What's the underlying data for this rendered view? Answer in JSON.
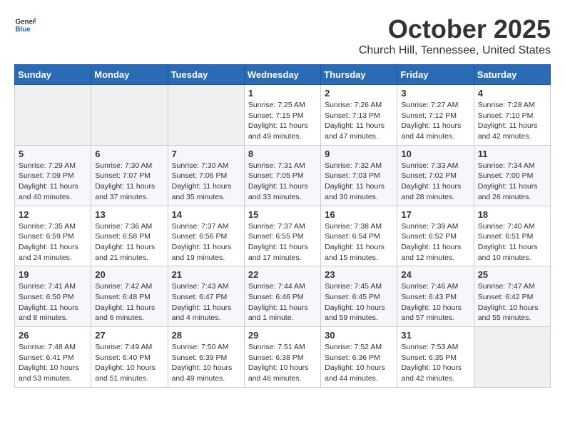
{
  "header": {
    "logo_general": "General",
    "logo_blue": "Blue",
    "month": "October 2025",
    "location": "Church Hill, Tennessee, United States"
  },
  "weekdays": [
    "Sunday",
    "Monday",
    "Tuesday",
    "Wednesday",
    "Thursday",
    "Friday",
    "Saturday"
  ],
  "weeks": [
    [
      {
        "day": "",
        "info": ""
      },
      {
        "day": "",
        "info": ""
      },
      {
        "day": "",
        "info": ""
      },
      {
        "day": "1",
        "info": "Sunrise: 7:25 AM\nSunset: 7:15 PM\nDaylight: 11 hours\nand 49 minutes."
      },
      {
        "day": "2",
        "info": "Sunrise: 7:26 AM\nSunset: 7:13 PM\nDaylight: 11 hours\nand 47 minutes."
      },
      {
        "day": "3",
        "info": "Sunrise: 7:27 AM\nSunset: 7:12 PM\nDaylight: 11 hours\nand 44 minutes."
      },
      {
        "day": "4",
        "info": "Sunrise: 7:28 AM\nSunset: 7:10 PM\nDaylight: 11 hours\nand 42 minutes."
      }
    ],
    [
      {
        "day": "5",
        "info": "Sunrise: 7:29 AM\nSunset: 7:09 PM\nDaylight: 11 hours\nand 40 minutes."
      },
      {
        "day": "6",
        "info": "Sunrise: 7:30 AM\nSunset: 7:07 PM\nDaylight: 11 hours\nand 37 minutes."
      },
      {
        "day": "7",
        "info": "Sunrise: 7:30 AM\nSunset: 7:06 PM\nDaylight: 11 hours\nand 35 minutes."
      },
      {
        "day": "8",
        "info": "Sunrise: 7:31 AM\nSunset: 7:05 PM\nDaylight: 11 hours\nand 33 minutes."
      },
      {
        "day": "9",
        "info": "Sunrise: 7:32 AM\nSunset: 7:03 PM\nDaylight: 11 hours\nand 30 minutes."
      },
      {
        "day": "10",
        "info": "Sunrise: 7:33 AM\nSunset: 7:02 PM\nDaylight: 11 hours\nand 28 minutes."
      },
      {
        "day": "11",
        "info": "Sunrise: 7:34 AM\nSunset: 7:00 PM\nDaylight: 11 hours\nand 26 minutes."
      }
    ],
    [
      {
        "day": "12",
        "info": "Sunrise: 7:35 AM\nSunset: 6:59 PM\nDaylight: 11 hours\nand 24 minutes."
      },
      {
        "day": "13",
        "info": "Sunrise: 7:36 AM\nSunset: 6:58 PM\nDaylight: 11 hours\nand 21 minutes."
      },
      {
        "day": "14",
        "info": "Sunrise: 7:37 AM\nSunset: 6:56 PM\nDaylight: 11 hours\nand 19 minutes."
      },
      {
        "day": "15",
        "info": "Sunrise: 7:37 AM\nSunset: 6:55 PM\nDaylight: 11 hours\nand 17 minutes."
      },
      {
        "day": "16",
        "info": "Sunrise: 7:38 AM\nSunset: 6:54 PM\nDaylight: 11 hours\nand 15 minutes."
      },
      {
        "day": "17",
        "info": "Sunrise: 7:39 AM\nSunset: 6:52 PM\nDaylight: 11 hours\nand 12 minutes."
      },
      {
        "day": "18",
        "info": "Sunrise: 7:40 AM\nSunset: 6:51 PM\nDaylight: 11 hours\nand 10 minutes."
      }
    ],
    [
      {
        "day": "19",
        "info": "Sunrise: 7:41 AM\nSunset: 6:50 PM\nDaylight: 11 hours\nand 8 minutes."
      },
      {
        "day": "20",
        "info": "Sunrise: 7:42 AM\nSunset: 6:48 PM\nDaylight: 11 hours\nand 6 minutes."
      },
      {
        "day": "21",
        "info": "Sunrise: 7:43 AM\nSunset: 6:47 PM\nDaylight: 11 hours\nand 4 minutes."
      },
      {
        "day": "22",
        "info": "Sunrise: 7:44 AM\nSunset: 6:46 PM\nDaylight: 11 hours\nand 1 minute."
      },
      {
        "day": "23",
        "info": "Sunrise: 7:45 AM\nSunset: 6:45 PM\nDaylight: 10 hours\nand 59 minutes."
      },
      {
        "day": "24",
        "info": "Sunrise: 7:46 AM\nSunset: 6:43 PM\nDaylight: 10 hours\nand 57 minutes."
      },
      {
        "day": "25",
        "info": "Sunrise: 7:47 AM\nSunset: 6:42 PM\nDaylight: 10 hours\nand 55 minutes."
      }
    ],
    [
      {
        "day": "26",
        "info": "Sunrise: 7:48 AM\nSunset: 6:41 PM\nDaylight: 10 hours\nand 53 minutes."
      },
      {
        "day": "27",
        "info": "Sunrise: 7:49 AM\nSunset: 6:40 PM\nDaylight: 10 hours\nand 51 minutes."
      },
      {
        "day": "28",
        "info": "Sunrise: 7:50 AM\nSunset: 6:39 PM\nDaylight: 10 hours\nand 49 minutes."
      },
      {
        "day": "29",
        "info": "Sunrise: 7:51 AM\nSunset: 6:38 PM\nDaylight: 10 hours\nand 46 minutes."
      },
      {
        "day": "30",
        "info": "Sunrise: 7:52 AM\nSunset: 6:36 PM\nDaylight: 10 hours\nand 44 minutes."
      },
      {
        "day": "31",
        "info": "Sunrise: 7:53 AM\nSunset: 6:35 PM\nDaylight: 10 hours\nand 42 minutes."
      },
      {
        "day": "",
        "info": ""
      }
    ]
  ]
}
